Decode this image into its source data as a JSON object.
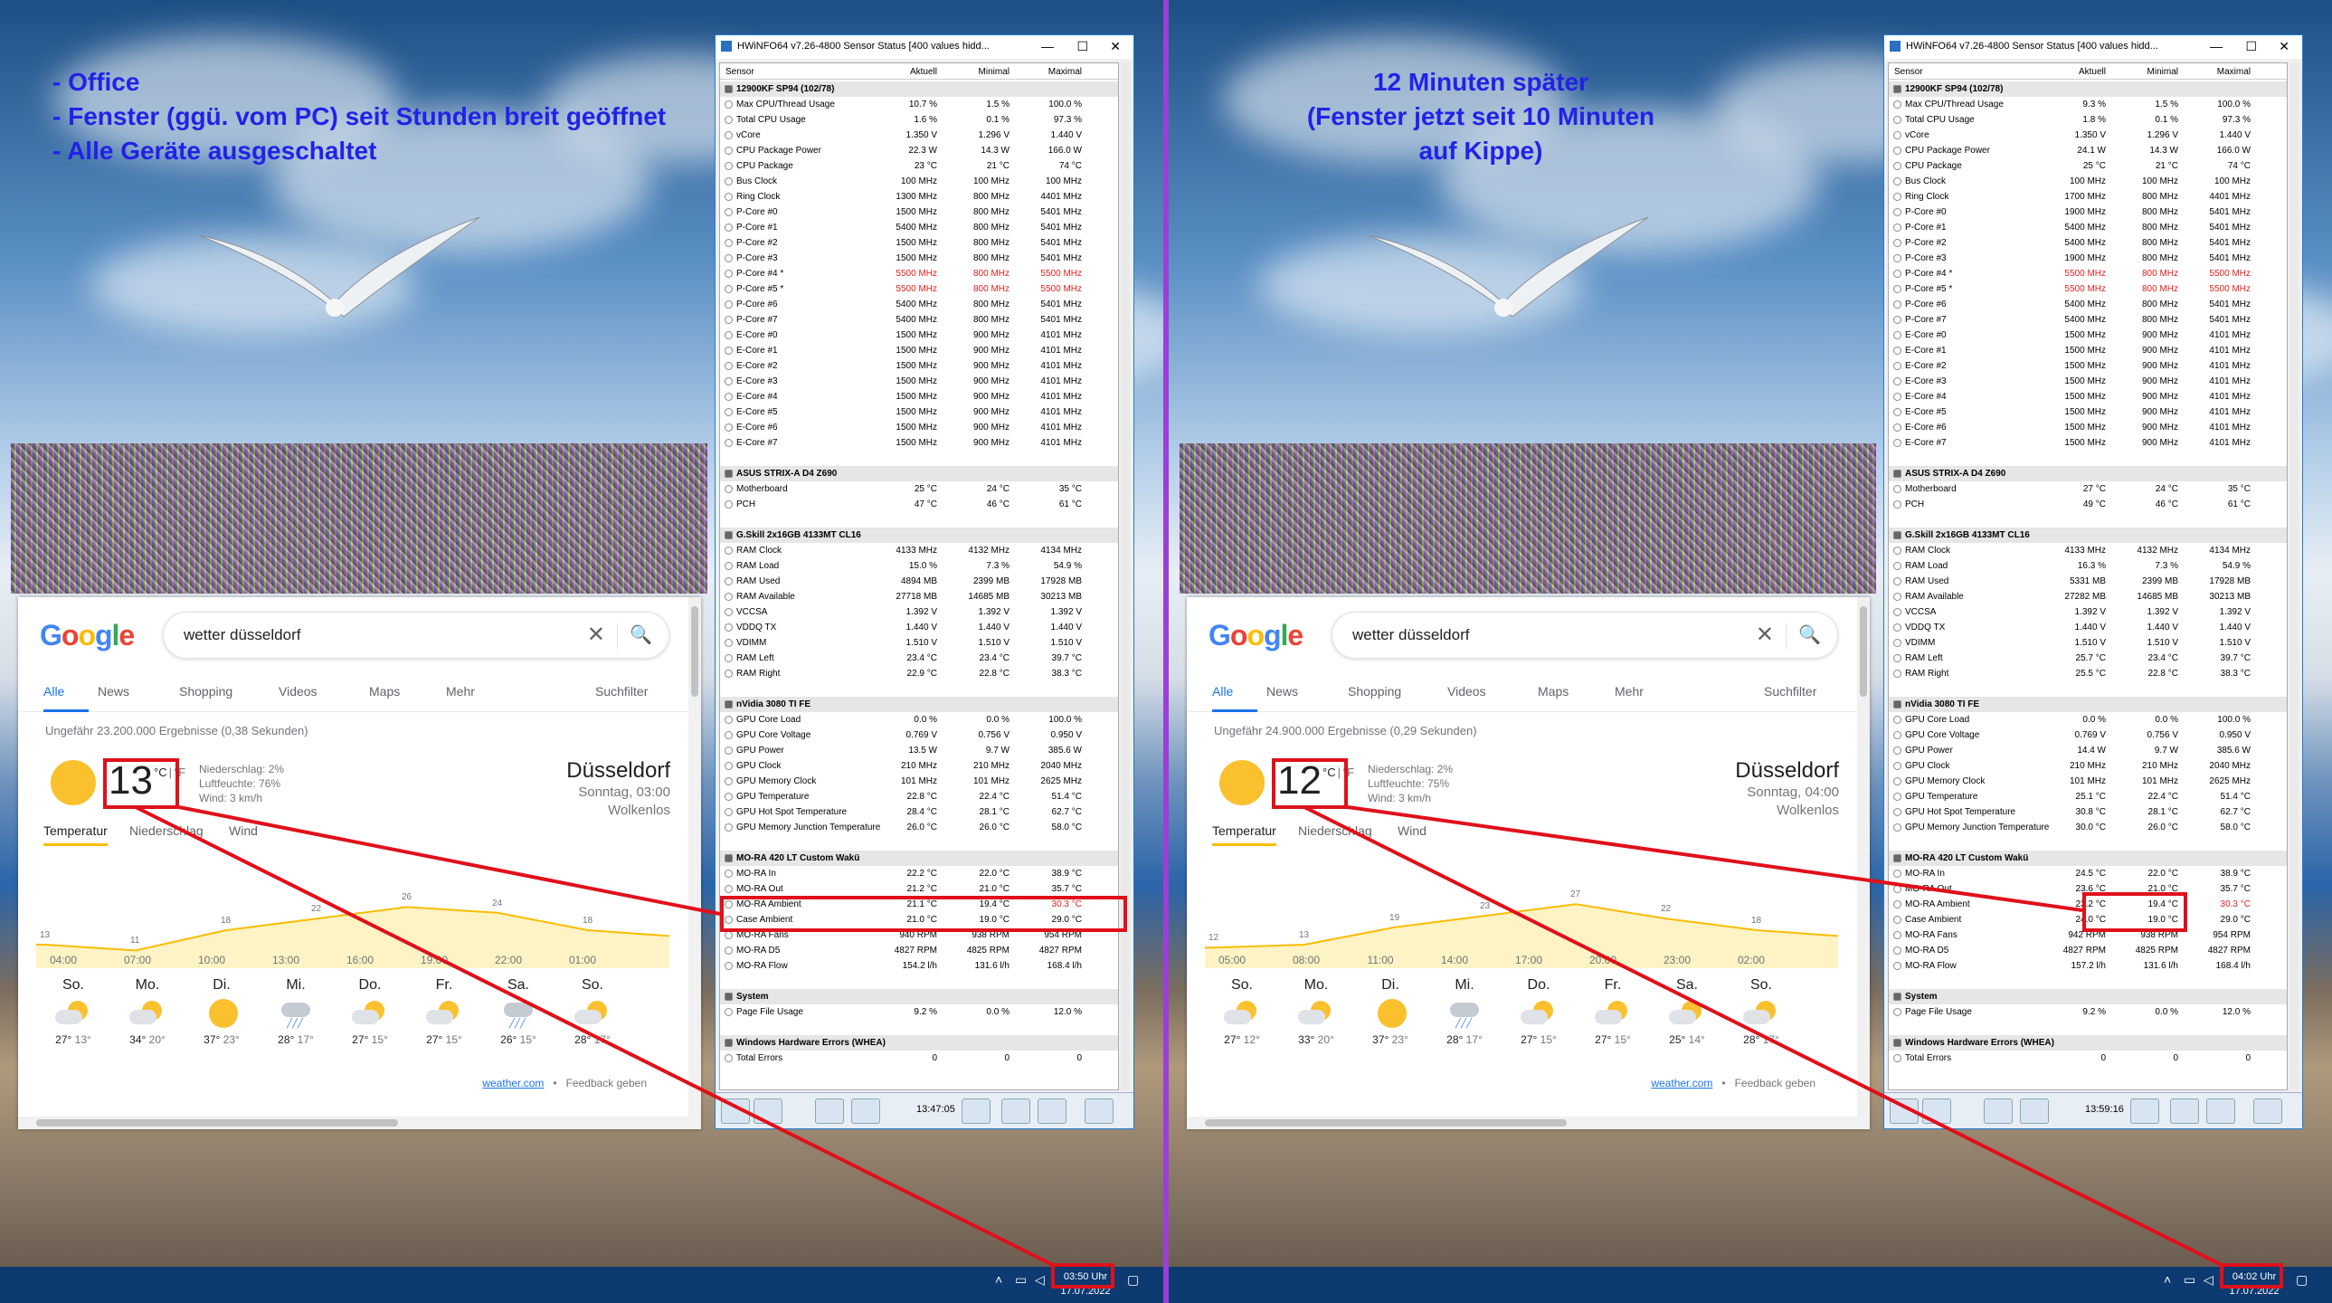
{
  "left": {
    "note_lines": [
      "- Office",
      "- Fenster (ggü. vom PC) seit Stunden breit geöffnet",
      "- Alle Geräte ausgeschaltet"
    ],
    "google": {
      "query": "wetter düsseldorf",
      "tabs": [
        "Alle",
        "News",
        "Shopping",
        "Videos",
        "Maps",
        "Mehr"
      ],
      "tools": "Suchfilter",
      "result_count": "Ungefähr 23.200.000 Ergebnisse (0,38 Sekunden)",
      "temp": "13",
      "unit_c": "°C",
      "unit_sep": "|",
      "unit_f": "°F",
      "precip": "Niederschlag: 2%",
      "humidity": "Luftfeuchte: 76%",
      "wind": "Wind: 3 km/h",
      "city": "Düsseldorf",
      "date": "Sonntag, 03:00",
      "cond": "Wolkenlos",
      "wtabs": [
        "Temperatur",
        "Niederschlag",
        "Wind"
      ],
      "chart_labels": [
        "13",
        "11",
        "18",
        "22",
        "26",
        "24",
        "18"
      ],
      "hours": [
        "04:00",
        "07:00",
        "10:00",
        "13:00",
        "16:00",
        "19:00",
        "22:00",
        "01:00"
      ],
      "days": [
        {
          "name": "So.",
          "hi": "27°",
          "lo": "13°",
          "icon": "partly-cloudy-icon"
        },
        {
          "name": "Mo.",
          "hi": "34°",
          "lo": "20°",
          "icon": "partly-cloudy-icon"
        },
        {
          "name": "Di.",
          "hi": "37°",
          "lo": "23°",
          "icon": "sun-icon"
        },
        {
          "name": "Mi.",
          "hi": "28°",
          "lo": "17°",
          "icon": "rain-icon"
        },
        {
          "name": "Do.",
          "hi": "27°",
          "lo": "15°",
          "icon": "partly-cloudy-icon"
        },
        {
          "name": "Fr.",
          "hi": "27°",
          "lo": "15°",
          "icon": "partly-cloudy-icon"
        },
        {
          "name": "Sa.",
          "hi": "26°",
          "lo": "15°",
          "icon": "rain-icon"
        },
        {
          "name": "So.",
          "hi": "28°",
          "lo": "17°",
          "icon": "partly-cloudy-icon"
        }
      ],
      "footer_link": "weather.com",
      "footer_sep": "•",
      "footer_fb": "Feedback geben"
    },
    "hw": {
      "title": "HWiNFO64 v7.26-4800 Sensor Status [400 values hidd...",
      "time": "13:47:05",
      "values": {
        "cpu": [
          [
            "10.7 %",
            "1.5 %",
            "100.0 %"
          ],
          [
            "1.6 %",
            "0.1 %",
            "97.3 %"
          ],
          [
            "1.350 V",
            "1.296 V",
            "1.440 V"
          ],
          [
            "22.3 W",
            "14.3 W",
            "166.0 W"
          ],
          [
            "23 °C",
            "21 °C",
            "74 °C"
          ],
          [
            "100 MHz",
            "100 MHz",
            "100 MHz"
          ],
          [
            "1300 MHz",
            "800 MHz",
            "4401 MHz"
          ],
          [
            "1500 MHz",
            "800 MHz",
            "5401 MHz"
          ],
          [
            "5400 MHz",
            "800 MHz",
            "5401 MHz"
          ],
          [
            "1500 MHz",
            "800 MHz",
            "5401 MHz"
          ],
          [
            "1500 MHz",
            "800 MHz",
            "5401 MHz"
          ],
          [
            "5500 MHz",
            "800 MHz",
            "5500 MHz"
          ],
          [
            "5500 MHz",
            "800 MHz",
            "5500 MHz"
          ],
          [
            "5400 MHz",
            "800 MHz",
            "5401 MHz"
          ],
          [
            "5400 MHz",
            "800 MHz",
            "5401 MHz"
          ],
          [
            "1500 MHz",
            "900 MHz",
            "4101 MHz"
          ],
          [
            "1500 MHz",
            "900 MHz",
            "4101 MHz"
          ],
          [
            "1500 MHz",
            "900 MHz",
            "4101 MHz"
          ],
          [
            "1500 MHz",
            "900 MHz",
            "4101 MHz"
          ],
          [
            "1500 MHz",
            "900 MHz",
            "4101 MHz"
          ],
          [
            "1500 MHz",
            "900 MHz",
            "4101 MHz"
          ],
          [
            "1500 MHz",
            "900 MHz",
            "4101 MHz"
          ],
          [
            "1500 MHz",
            "900 MHz",
            "4101 MHz"
          ]
        ],
        "mb": [
          [
            "25 °C",
            "24 °C",
            "35 °C"
          ],
          [
            "47 °C",
            "46 °C",
            "61 °C"
          ]
        ],
        "ram": [
          [
            "4133 MHz",
            "4132 MHz",
            "4134 MHz"
          ],
          [
            "15.0 %",
            "7.3 %",
            "54.9 %"
          ],
          [
            "4894 MB",
            "2399 MB",
            "17928 MB"
          ],
          [
            "27718 MB",
            "14685 MB",
            "30213 MB"
          ],
          [
            "1.392 V",
            "1.392 V",
            "1.392 V"
          ],
          [
            "1.440 V",
            "1.440 V",
            "1.440 V"
          ],
          [
            "1.510 V",
            "1.510 V",
            "1.510 V"
          ],
          [
            "23.4 °C",
            "23.4 °C",
            "39.7 °C"
          ],
          [
            "22.9 °C",
            "22.8 °C",
            "38.3 °C"
          ]
        ],
        "gpu": [
          [
            "0.0 %",
            "0.0 %",
            "100.0 %"
          ],
          [
            "0.769 V",
            "0.756 V",
            "0.950 V"
          ],
          [
            "13.5 W",
            "9.7 W",
            "385.6 W"
          ],
          [
            "210 MHz",
            "210 MHz",
            "2040 MHz"
          ],
          [
            "101 MHz",
            "101 MHz",
            "2625 MHz"
          ],
          [
            "22.8 °C",
            "22.4 °C",
            "51.4 °C"
          ],
          [
            "28.4 °C",
            "28.1 °C",
            "62.7 °C"
          ],
          [
            "26.0 °C",
            "26.0 °C",
            "58.0 °C"
          ]
        ],
        "mora": [
          [
            "22.2 °C",
            "22.0 °C",
            "38.9 °C"
          ],
          [
            "21.2 °C",
            "21.0 °C",
            "35.7 °C"
          ],
          [
            "21.1 °C",
            "19.4 °C",
            "30.3 °C"
          ],
          [
            "21.0 °C",
            "19.0 °C",
            "29.0 °C"
          ],
          [
            "940 RPM",
            "938 RPM",
            "954 RPM"
          ],
          [
            "4827 RPM",
            "4825 RPM",
            "4827 RPM"
          ],
          [
            "154.2 l/h",
            "131.6 l/h",
            "168.4 l/h"
          ]
        ],
        "sys": [
          [
            "9.2 %",
            "0.0 %",
            "12.0 %"
          ]
        ],
        "whea": [
          [
            "0",
            "0",
            "0"
          ]
        ]
      }
    },
    "clock_time": "03:50 Uhr",
    "clock_date": "17.07.2022"
  },
  "right": {
    "note_lines": [
      "12 Minuten später",
      "(Fenster jetzt seit 10 Minuten auf Kippe)"
    ],
    "google": {
      "query": "wetter düsseldorf",
      "tabs": [
        "Alle",
        "News",
        "Shopping",
        "Videos",
        "Maps",
        "Mehr"
      ],
      "tools": "Suchfilter",
      "result_count": "Ungefähr 24.900.000 Ergebnisse (0,29 Sekunden)",
      "temp": "12",
      "unit_c": "°C",
      "unit_sep": "|",
      "unit_f": "°F",
      "precip": "Niederschlag: 2%",
      "humidity": "Luftfeuchte: 75%",
      "wind": "Wind: 3 km/h",
      "city": "Düsseldorf",
      "date": "Sonntag, 04:00",
      "cond": "Wolkenlos",
      "wtabs": [
        "Temperatur",
        "Niederschlag",
        "Wind"
      ],
      "chart_labels": [
        "12",
        "13",
        "19",
        "23",
        "27",
        "22",
        "18"
      ],
      "hours": [
        "05:00",
        "08:00",
        "11:00",
        "14:00",
        "17:00",
        "20:00",
        "23:00",
        "02:00"
      ],
      "days": [
        {
          "name": "So.",
          "hi": "27°",
          "lo": "12°",
          "icon": "partly-cloudy-icon"
        },
        {
          "name": "Mo.",
          "hi": "33°",
          "lo": "20°",
          "icon": "partly-cloudy-icon"
        },
        {
          "name": "Di.",
          "hi": "37°",
          "lo": "23°",
          "icon": "sun-icon"
        },
        {
          "name": "Mi.",
          "hi": "28°",
          "lo": "17°",
          "icon": "rain-icon"
        },
        {
          "name": "Do.",
          "hi": "27°",
          "lo": "15°",
          "icon": "partly-cloudy-icon"
        },
        {
          "name": "Fr.",
          "hi": "27°",
          "lo": "15°",
          "icon": "partly-cloudy-icon"
        },
        {
          "name": "Sa.",
          "hi": "25°",
          "lo": "14°",
          "icon": "partly-cloudy-icon"
        },
        {
          "name": "So.",
          "hi": "28°",
          "lo": "17°",
          "icon": "partly-cloudy-icon"
        }
      ],
      "footer_link": "weather.com",
      "footer_sep": "•",
      "footer_fb": "Feedback geben"
    },
    "hw": {
      "title": "HWiNFO64 v7.26-4800 Sensor Status [400 values hidd...",
      "time": "13:59:16",
      "values": {
        "cpu": [
          [
            "9.3 %",
            "1.5 %",
            "100.0 %"
          ],
          [
            "1.8 %",
            "0.1 %",
            "97.3 %"
          ],
          [
            "1.350 V",
            "1.296 V",
            "1.440 V"
          ],
          [
            "24.1 W",
            "14.3 W",
            "166.0 W"
          ],
          [
            "25 °C",
            "21 °C",
            "74 °C"
          ],
          [
            "100 MHz",
            "100 MHz",
            "100 MHz"
          ],
          [
            "1700 MHz",
            "800 MHz",
            "4401 MHz"
          ],
          [
            "1900 MHz",
            "800 MHz",
            "5401 MHz"
          ],
          [
            "5400 MHz",
            "800 MHz",
            "5401 MHz"
          ],
          [
            "5400 MHz",
            "800 MHz",
            "5401 MHz"
          ],
          [
            "1900 MHz",
            "800 MHz",
            "5401 MHz"
          ],
          [
            "5500 MHz",
            "800 MHz",
            "5500 MHz"
          ],
          [
            "5500 MHz",
            "800 MHz",
            "5500 MHz"
          ],
          [
            "5400 MHz",
            "800 MHz",
            "5401 MHz"
          ],
          [
            "5400 MHz",
            "800 MHz",
            "5401 MHz"
          ],
          [
            "1500 MHz",
            "900 MHz",
            "4101 MHz"
          ],
          [
            "1500 MHz",
            "900 MHz",
            "4101 MHz"
          ],
          [
            "1500 MHz",
            "900 MHz",
            "4101 MHz"
          ],
          [
            "1500 MHz",
            "900 MHz",
            "4101 MHz"
          ],
          [
            "1500 MHz",
            "900 MHz",
            "4101 MHz"
          ],
          [
            "1500 MHz",
            "900 MHz",
            "4101 MHz"
          ],
          [
            "1500 MHz",
            "900 MHz",
            "4101 MHz"
          ],
          [
            "1500 MHz",
            "900 MHz",
            "4101 MHz"
          ]
        ],
        "mb": [
          [
            "27 °C",
            "24 °C",
            "35 °C"
          ],
          [
            "49 °C",
            "46 °C",
            "61 °C"
          ]
        ],
        "ram": [
          [
            "4133 MHz",
            "4132 MHz",
            "4134 MHz"
          ],
          [
            "16.3 %",
            "7.3 %",
            "54.9 %"
          ],
          [
            "5331 MB",
            "2399 MB",
            "17928 MB"
          ],
          [
            "27282 MB",
            "14685 MB",
            "30213 MB"
          ],
          [
            "1.392 V",
            "1.392 V",
            "1.392 V"
          ],
          [
            "1.440 V",
            "1.440 V",
            "1.440 V"
          ],
          [
            "1.510 V",
            "1.510 V",
            "1.510 V"
          ],
          [
            "25.7 °C",
            "23.4 °C",
            "39.7 °C"
          ],
          [
            "25.5 °C",
            "22.8 °C",
            "38.3 °C"
          ]
        ],
        "gpu": [
          [
            "0.0 %",
            "0.0 %",
            "100.0 %"
          ],
          [
            "0.769 V",
            "0.756 V",
            "0.950 V"
          ],
          [
            "14.4 W",
            "9.7 W",
            "385.6 W"
          ],
          [
            "210 MHz",
            "210 MHz",
            "2040 MHz"
          ],
          [
            "101 MHz",
            "101 MHz",
            "2625 MHz"
          ],
          [
            "25.1 °C",
            "22.4 °C",
            "51.4 °C"
          ],
          [
            "30.8 °C",
            "28.1 °C",
            "62.7 °C"
          ],
          [
            "30.0 °C",
            "26.0 °C",
            "58.0 °C"
          ]
        ],
        "mora": [
          [
            "24.5 °C",
            "22.0 °C",
            "38.9 °C"
          ],
          [
            "23.6 °C",
            "21.0 °C",
            "35.7 °C"
          ],
          [
            "23.2 °C",
            "19.4 °C",
            "30.3 °C"
          ],
          [
            "24.0 °C",
            "19.0 °C",
            "29.0 °C"
          ],
          [
            "942 RPM",
            "938 RPM",
            "954 RPM"
          ],
          [
            "4827 RPM",
            "4825 RPM",
            "4827 RPM"
          ],
          [
            "157.2 l/h",
            "131.6 l/h",
            "168.4 l/h"
          ]
        ],
        "sys": [
          [
            "9.2 %",
            "0.0 %",
            "12.0 %"
          ]
        ],
        "whea": [
          [
            "0",
            "0",
            "0"
          ]
        ]
      }
    },
    "clock_time": "04:02 Uhr",
    "clock_date": "17.07.2022"
  },
  "hw_labels": {
    "header": [
      "Sensor",
      "Aktuell",
      "Minimal",
      "Maximal"
    ],
    "cpu_group": "12900KF SP94 (102/78)",
    "cpu": [
      "Max CPU/Thread Usage",
      "Total CPU Usage",
      "vCore",
      "CPU Package Power",
      "CPU Package",
      "Bus Clock",
      "Ring Clock",
      "P-Core #0",
      "P-Core #1",
      "P-Core #2",
      "P-Core #3",
      "P-Core #4 *",
      "P-Core #5 *",
      "P-Core #6",
      "P-Core #7",
      "E-Core #0",
      "E-Core #1",
      "E-Core #2",
      "E-Core #3",
      "E-Core #4",
      "E-Core #5",
      "E-Core #6",
      "E-Core #7"
    ],
    "mb_group": "ASUS STRIX-A D4 Z690",
    "mb": [
      "Motherboard",
      "PCH"
    ],
    "ram_group": "G.Skill 2x16GB 4133MT CL16",
    "ram": [
      "RAM Clock",
      "RAM Load",
      "RAM Used",
      "RAM Available",
      "VCCSA",
      "VDDQ TX",
      "VDIMM",
      "RAM Left",
      "RAM Right"
    ],
    "gpu_group": "nVidia 3080 TI FE",
    "gpu": [
      "GPU Core Load",
      "GPU Core Voltage",
      "GPU Power",
      "GPU Clock",
      "GPU Memory Clock",
      "GPU Temperature",
      "GPU Hot Spot Temperature",
      "GPU Memory Junction Temperature"
    ],
    "mora_group": "MO-RA 420 LT Custom Wakü",
    "mora": [
      "MO-RA In",
      "MO-RA Out",
      "MO-RA Ambient",
      "Case Ambient",
      "MO-RA Fans",
      "MO-RA D5",
      "MO-RA Flow"
    ],
    "sys_group": "System",
    "sys": [
      "Page File Usage"
    ],
    "whea_group": "Windows Hardware Errors (WHEA)",
    "whea": [
      "Total Errors"
    ]
  },
  "colors": {
    "annotation_text": "#2222e6",
    "highlight": "#e0101a",
    "divider": "#9b3fd6",
    "taskbar": "#0d3a70"
  }
}
